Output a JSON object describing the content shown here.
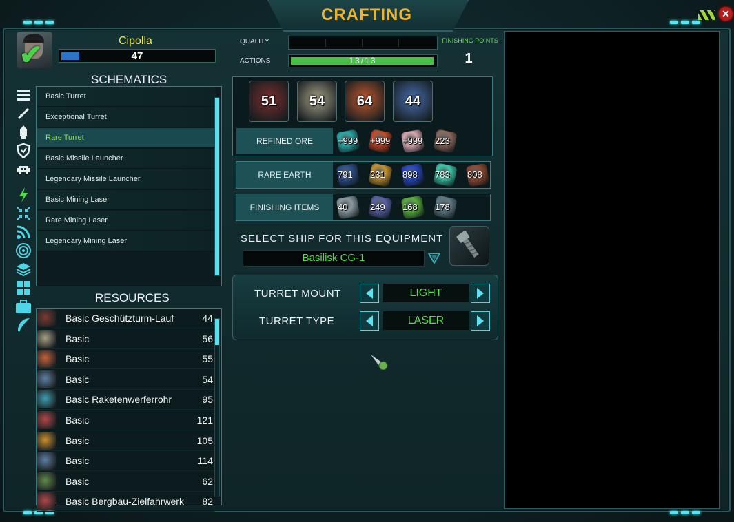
{
  "window": {
    "title": "CRAFTING",
    "close_label": "✕"
  },
  "player": {
    "name": "Cipolla",
    "level": "47",
    "xp_fraction": 0.12
  },
  "schematics": {
    "title": "SCHEMATICS",
    "items": [
      {
        "label": "Basic Turret",
        "selected": false
      },
      {
        "label": "Exceptional Turret",
        "selected": false
      },
      {
        "label": "Rare Turret",
        "selected": true
      },
      {
        "label": "Basic Missile Launcher",
        "selected": false
      },
      {
        "label": "Legendary Missile Launcher",
        "selected": false
      },
      {
        "label": "Basic Mining Laser",
        "selected": false
      },
      {
        "label": "Rare Mining Laser",
        "selected": false
      },
      {
        "label": "Legendary Mining Laser",
        "selected": false
      }
    ]
  },
  "sidebar_icons": [
    "menu-icon",
    "sword-icon",
    "rocket-icon",
    "shield-icon",
    "invader-icon",
    "lightning-icon",
    "collapse-arrows-icon",
    "signal-icon",
    "target-icon",
    "layers-icon",
    "grid-icon",
    "briefcase-icon",
    "feather-icon"
  ],
  "resources": {
    "title": "RESOURCES",
    "items": [
      {
        "name": "Basic Geschützturm-Lauf",
        "value": "44",
        "color": "#7a3a33"
      },
      {
        "name": "Basic",
        "value": "56",
        "color": "#a59e82"
      },
      {
        "name": "Basic",
        "value": "55",
        "color": "#c4613b"
      },
      {
        "name": "Basic",
        "value": "54",
        "color": "#5d7fa3"
      },
      {
        "name": "Basic Raketenwerferrohr",
        "value": "95",
        "color": "#3c9fb0"
      },
      {
        "name": "Basic",
        "value": "121",
        "color": "#b04848"
      },
      {
        "name": "Basic",
        "value": "105",
        "color": "#c9902e"
      },
      {
        "name": "Basic",
        "value": "114",
        "color": "#5d7fa3"
      },
      {
        "name": "Basic",
        "value": "62",
        "color": "#5f8a4a"
      },
      {
        "name": "Basic Bergbau-Zielfahrwerk",
        "value": "82",
        "color": "#b04848"
      }
    ]
  },
  "crafting": {
    "quality_label": "QUALITY",
    "actions_label": "ACTIONS",
    "actions_text": "13/13",
    "actions_fraction": 1.0,
    "finishing_points_label": "FINISHING POINTS",
    "finishing_points": "1"
  },
  "components": [
    {
      "value": "51",
      "color": "#7a2f2f"
    },
    {
      "value": "54",
      "color": "#a8a188"
    },
    {
      "value": "64",
      "color": "#c35a30"
    },
    {
      "value": "44",
      "color": "#4a6fb0"
    }
  ],
  "refined_ore": {
    "label": "REFINED ORE",
    "items": [
      {
        "value": "+999",
        "color": "#2aa8a8"
      },
      {
        "value": "+999",
        "color": "#c64a2a"
      },
      {
        "value": "+999",
        "color": "#d8a8b0"
      },
      {
        "value": "223",
        "color": "#8a6a5e"
      }
    ]
  },
  "rare_earth": {
    "label": "RARE EARTH",
    "items": [
      {
        "value": "791",
        "color": "#2e4f8a"
      },
      {
        "value": "231",
        "color": "#c59232"
      },
      {
        "value": "898",
        "color": "#2848c0"
      },
      {
        "value": "783",
        "color": "#3cc6a8"
      },
      {
        "value": "808",
        "color": "#8e4a34"
      }
    ]
  },
  "finishing_items": {
    "label": "FINISHING ITEMS",
    "items": [
      {
        "value": "40",
        "color": "#8a9aa0"
      },
      {
        "value": "249",
        "color": "#5a62a8"
      },
      {
        "value": "168",
        "color": "#58b040"
      },
      {
        "value": "178",
        "color": "#607a86"
      }
    ]
  },
  "ship": {
    "label": "SELECT SHIP FOR THIS EQUIPMENT",
    "selected": "Basilisk CG-1"
  },
  "options": [
    {
      "label": "TURRET MOUNT",
      "value": "LIGHT"
    },
    {
      "label": "TURRET TYPE",
      "value": "LASER"
    }
  ]
}
